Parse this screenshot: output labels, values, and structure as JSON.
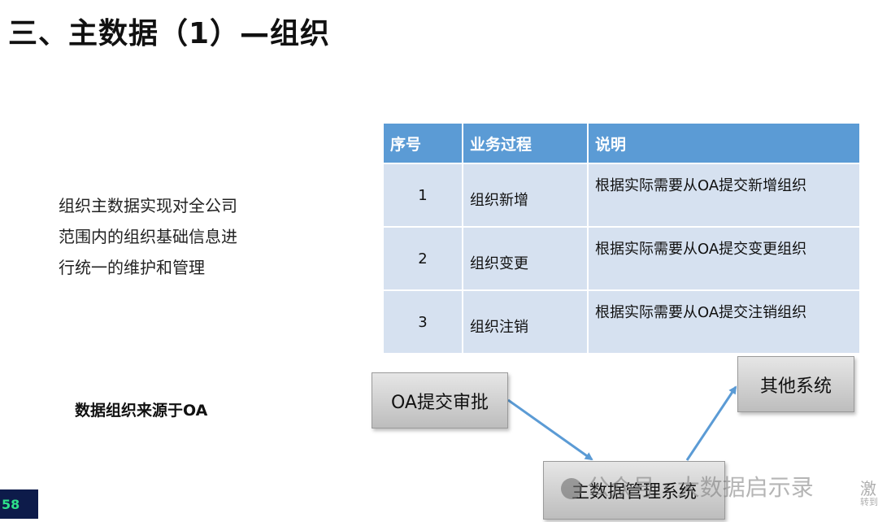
{
  "title": "三、主数据（1）—组织",
  "description": [
    "组织主数据实现对全公司",
    "范围内的组织基础信息进",
    "行统一的维护和管理"
  ],
  "source_note": "数据组织来源于OA",
  "table": {
    "headers": [
      "序号",
      "业务过程",
      "说明"
    ],
    "rows": [
      [
        "1",
        "组织新增",
        "根据实际需要从OA提交新增组织"
      ],
      [
        "2",
        "组织变更",
        "根据实际需要从OA提交变更组织"
      ],
      [
        "3",
        "组织注销",
        "根据实际需要从OA提交注销组织"
      ]
    ]
  },
  "flow": {
    "oa_box": "OA提交审批",
    "master_box": "主数据管理系统",
    "other_box": "其他系统",
    "arrow_color": "#5b9bd5"
  },
  "page_number": "58",
  "watermark": {
    "text": "公众号 · 大数据启示录",
    "side_char": "激",
    "side_small": "转到"
  }
}
